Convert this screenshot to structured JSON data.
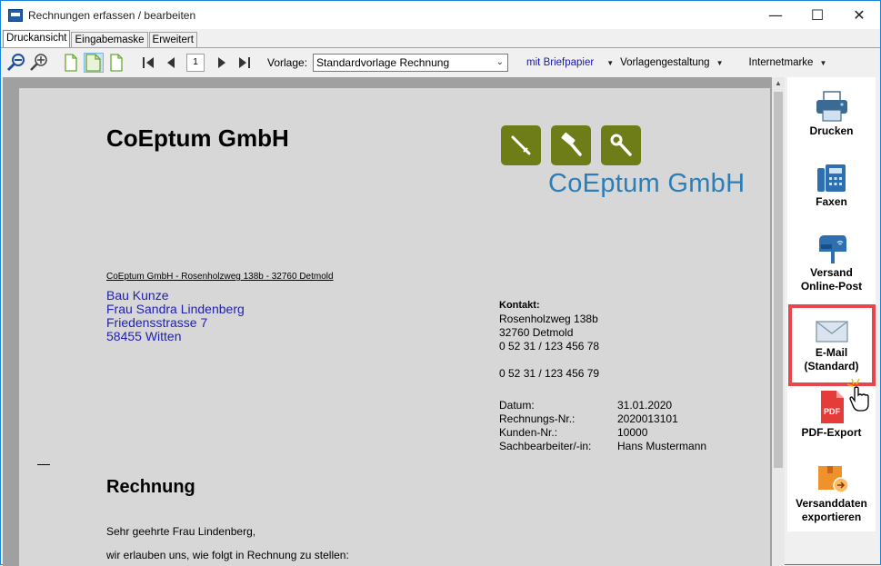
{
  "window": {
    "title": "Rechnungen erfassen / bearbeiten",
    "controls": [
      "—",
      "☐",
      "✕"
    ]
  },
  "tabs": [
    {
      "label": "Druckansicht",
      "active": true
    },
    {
      "label": "Eingabemaske",
      "active": false
    },
    {
      "label": "Erweitert",
      "active": false
    }
  ],
  "toolbar": {
    "page_number": "1",
    "vorlage_label": "Vorlage:",
    "vorlage_value": "Standardvorlage Rechnung",
    "briefpapier_link": "mit Briefpapier",
    "vorlagengestaltung": "Vorlagengestaltung",
    "internetmarke": "Internetmarke"
  },
  "document": {
    "company_heading": "CoEptum GmbH",
    "logo_text": "CoEptum GmbH",
    "sender_line": "CoEptum GmbH - Rosenholzweg 138b - 32760 Detmold",
    "recipient": [
      "Bau Kunze",
      "Frau Sandra Lindenberg",
      "Friedensstrasse 7",
      "58455 Witten"
    ],
    "contact_label": "Kontakt:",
    "contact_lines": [
      "Rosenholzweg 138b",
      "32760 Detmold",
      "0 52 31 / 123 456 78"
    ],
    "fax": "0 52 31 / 123 456 79",
    "meta": [
      {
        "key": "Datum:",
        "value": "31.01.2020"
      },
      {
        "key": "Rechnungs-Nr.:",
        "value": "2020013101"
      },
      {
        "key": "Kunden-Nr.:",
        "value": "10000"
      },
      {
        "key": "Sachbearbeiter/-in:",
        "value": "Hans Mustermann"
      }
    ],
    "heading": "Rechnung",
    "salutation": "Sehr geehrte Frau Lindenberg,",
    "intro": "wir erlauben uns, wie folgt in Rechnung zu stellen:"
  },
  "actions": {
    "print": "Drucken",
    "fax": "Faxen",
    "online_post_1": "Versand",
    "online_post_2": "Online-Post",
    "email_1": "E-Mail",
    "email_2": "(Standard)",
    "pdf": "PDF-Export",
    "pdf_icon_text": "PDF",
    "export_1": "Versanddaten",
    "export_2": "exportieren"
  },
  "colors": {
    "accent_border": "#e8454c",
    "logo_green": "#6f7d19",
    "logo_blue": "#2b7eb8",
    "address_blue": "#1f1fb0"
  }
}
